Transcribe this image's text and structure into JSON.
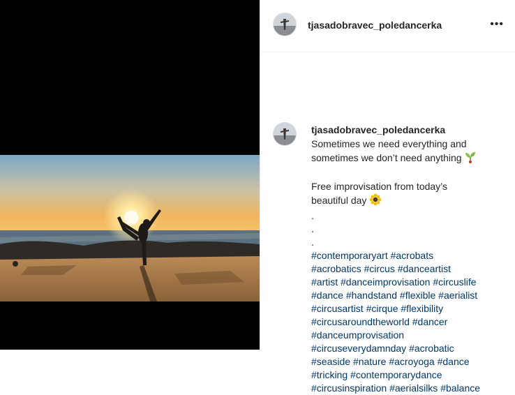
{
  "post": {
    "username": "tjasadobravec_poledancerka",
    "more_icon": "more-options-icon",
    "caption": {
      "username": "tjasadobravec_poledancerka",
      "line1": "Sometimes we need everything and",
      "line2": "sometimes we don’t need anything",
      "line2_emoji": "seedling-emoji",
      "line3": "Free improvisation from today’s",
      "line4": "beautiful day",
      "line4_emoji": "sunflower-emoji",
      "dots": [
        ".",
        ".",
        "."
      ],
      "hashtag_lines": [
        [
          "#contemporaryart",
          "#acrobats"
        ],
        [
          "#acrobatics",
          "#circus",
          "#danceartist"
        ],
        [
          "#artist",
          "#danceimprovisation",
          "#circuslife"
        ],
        [
          "#dance",
          "#handstand",
          "#flexible",
          "#aerialist"
        ],
        [
          "#circusartist",
          "#cirque",
          "#flexibility"
        ],
        [
          "#circusaroundtheworld",
          "#dancer"
        ],
        [
          "#danceumprovisation"
        ],
        [
          "#circuseverydamnday",
          "#acrobatic"
        ],
        [
          "#seaside",
          "#nature",
          "#acroyoga",
          "#dance"
        ],
        [
          "#tricking",
          "#contemporarydance"
        ],
        [
          "#circusinspiration",
          "#aerialsilks",
          "#balance"
        ]
      ]
    }
  }
}
